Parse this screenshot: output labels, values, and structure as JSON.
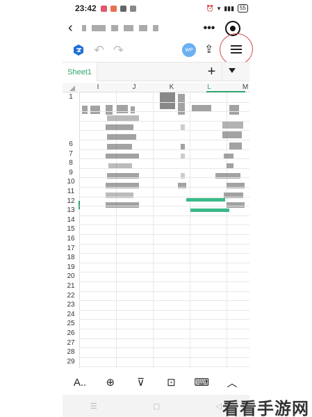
{
  "status": {
    "time": "23:42",
    "battery": "55"
  },
  "toolbar": {
    "avatar_text": "WP"
  },
  "sheet": {
    "tab_label": "Sheet1",
    "add_label": "+"
  },
  "grid": {
    "columns": [
      "I",
      "J",
      "K",
      "L",
      "M"
    ],
    "rows": [
      "1",
      "",
      "",
      "",
      "",
      "6",
      "7",
      "8",
      "9",
      "10",
      "11",
      "12",
      "13",
      "14",
      "15",
      "16",
      "17",
      "18",
      "19",
      "20",
      "21",
      "22",
      "23",
      "24",
      "25",
      "26",
      "27",
      "28",
      "29"
    ]
  },
  "watermark": "看看手游网",
  "colors": {
    "accent": "#2da36c",
    "annotation": "#d84a4a"
  }
}
